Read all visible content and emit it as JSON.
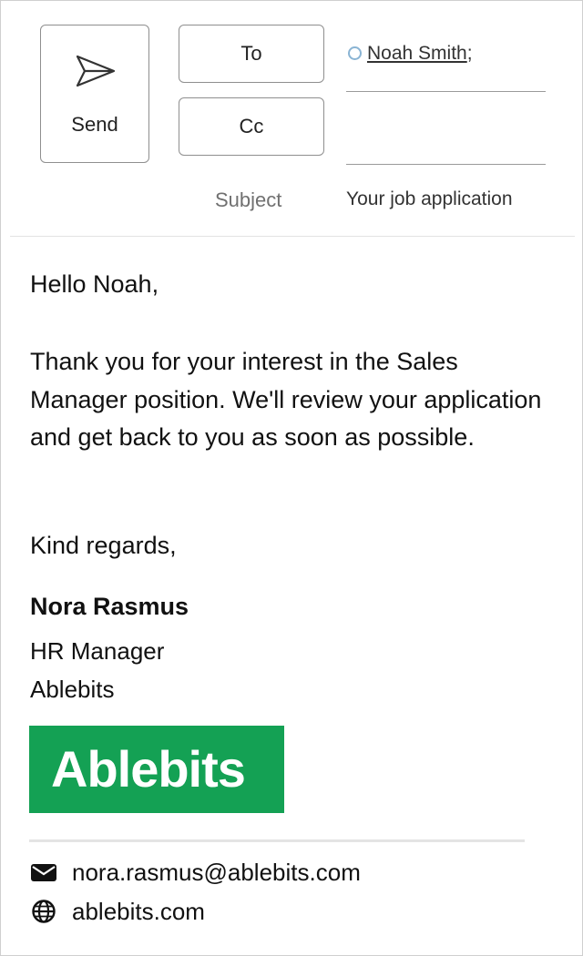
{
  "compose": {
    "send_label": "Send",
    "to_label": "To",
    "cc_label": "Cc",
    "subject_label": "Subject",
    "recipients": [
      {
        "name": "Noah Smith",
        "separator": ";"
      }
    ],
    "cc_value": "",
    "subject_value": "Your job application"
  },
  "message": {
    "greeting": "Hello Noah,",
    "paragraph": "Thank you for your interest in the Sales Manager position. We'll review your application and get back to you as soon as possible.",
    "closing": "Kind regards,"
  },
  "signature": {
    "name": "Nora Rasmus",
    "title": "HR Manager",
    "company": "Ablebits",
    "logo_text": "Ablebits",
    "logo_color": "#14a154",
    "email": "nora.rasmus@ablebits.com",
    "email_icon": "envelope-icon",
    "website": "ablebits.com",
    "website_icon": "globe-icon"
  }
}
